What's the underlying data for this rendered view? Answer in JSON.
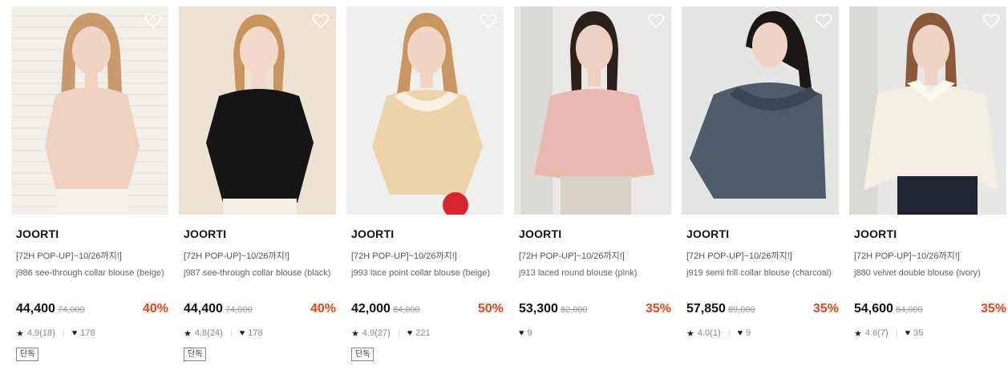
{
  "products": [
    {
      "brand": "JOORTI",
      "promo": "[72H POP-UP]~10/26까지!]",
      "name": "j986 see-through collar blouse (beige)",
      "price": "44,400",
      "original_price": "74,000",
      "discount": "40%",
      "rating": "4.9(18)",
      "likes": "178",
      "tag": "단독",
      "bg": "#f2efe9",
      "top": "#efd2bf",
      "skin": "#f0d5c4",
      "hair": "#c99a6e",
      "bottom": "#f4f1ea"
    },
    {
      "brand": "JOORTI",
      "promo": "[72H POP-UP]~10/26까지!]",
      "name": "j987 see-through collar blouse (black)",
      "price": "44,400",
      "original_price": "74,000",
      "discount": "40%",
      "rating": "4.8(24)",
      "likes": "178",
      "tag": "단독",
      "bg": "#ede2d3",
      "top": "#151515",
      "skin": "#f2d8c8",
      "hair": "#c9955f",
      "bottom": "#f3eee5"
    },
    {
      "brand": "JOORTI",
      "promo": "[72H POP-UP]~10/26까지!]",
      "name": "j993 lace point collar blouse (beige)",
      "price": "42,000",
      "original_price": "84,000",
      "discount": "50%",
      "rating": "4.9(27)",
      "likes": "221",
      "tag": "단독",
      "bg": "#eeeeec",
      "top": "#ecd3a9",
      "skin": "#f1d6c6",
      "hair": "#c99561",
      "bottom": "#f4f1ea"
    },
    {
      "brand": "JOORTI",
      "promo": "[72H POP-UP]~10/26까지!]",
      "name": "j913 laced round blouse (pink)",
      "price": "53,300",
      "original_price": "82,000",
      "discount": "35%",
      "rating": "",
      "likes": "9",
      "tag": "",
      "bg": "#e9e8e6",
      "top": "#eab9b2",
      "skin": "#edd0c1",
      "hair": "#2a211c",
      "bottom": "#d8d2c8"
    },
    {
      "brand": "JOORTI",
      "promo": "[72H POP-UP]~10/26까지!]",
      "name": "j919 semi frill collar blouse (charcoal)",
      "price": "57,850",
      "original_price": "89,000",
      "discount": "35%",
      "rating": "4.0(1)",
      "likes": "9",
      "tag": "",
      "bg": "#e4e4e2",
      "top": "#4f5b68",
      "skin": "#efd3c4",
      "hair": "#1b1714",
      "bottom": "#3b434d"
    },
    {
      "brand": "JOORTI",
      "promo": "[72H POP-UP]~10/26까지!]",
      "name": "j880 velvet double blouse (ivory)",
      "price": "54,600",
      "original_price": "84,000",
      "discount": "35%",
      "rating": "4.6(7)",
      "likes": "35",
      "tag": "",
      "bg": "#e7e7e5",
      "top": "#f2eee3",
      "skin": "#f0d4c3",
      "hair": "#8a5a3a",
      "bottom": "#1e2530"
    }
  ]
}
